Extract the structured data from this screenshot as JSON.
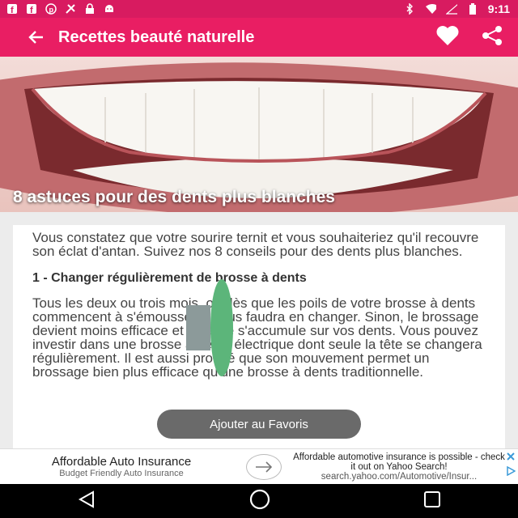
{
  "status_bar": {
    "time": "9:11",
    "left_icons": [
      "facebook-icon",
      "facebook-icon",
      "pinterest-icon",
      "app-icon",
      "lock-icon",
      "android-icon"
    ],
    "right_icons": [
      "bluetooth-icon",
      "wifi-icon",
      "signal-icon",
      "battery-icon"
    ]
  },
  "app_bar": {
    "title": "Recettes beauté naturelle",
    "background": "#e91e63"
  },
  "hero": {
    "title": "8 astuces pour des dents plus blanches"
  },
  "article": {
    "intro": "Vous constatez que votre sourire ternit et vous souhaiteriez qu'il recouvre son éclat d'antan. Suivez nos 8 conseils pour des dents plus blanches.",
    "section1_heading": "1 - Changer régulièrement de brosse à dents",
    "section1_body": "Tous les deux ou trois mois, ou dès que les poils de votre brosse à dents commencent à s'émousser, il vous faudra en changer. Sinon, le brossage devient moins efficace et le tartre s'accumule sur vos dents. Vous pouvez investir dans une brosse à dents électrique dont seule la tête se changera régulièrement. Il est aussi prouvé que son mouvement permet un brossage bien plus efficace qu'une brosse à dents traditionnelle."
  },
  "toast": {
    "text": "Ajouter au Favoris"
  },
  "ad": {
    "headline": "Affordable Auto Insurance",
    "subtitle": "Budget Friendly Auto Insurance",
    "description": "Affordable automotive insurance is possible - check it out on Yahoo Search!",
    "url": "search.yahoo.com/Automotive/Insur..."
  },
  "nav_bar": {
    "buttons": [
      "back-icon",
      "home-icon",
      "recents-icon"
    ]
  }
}
